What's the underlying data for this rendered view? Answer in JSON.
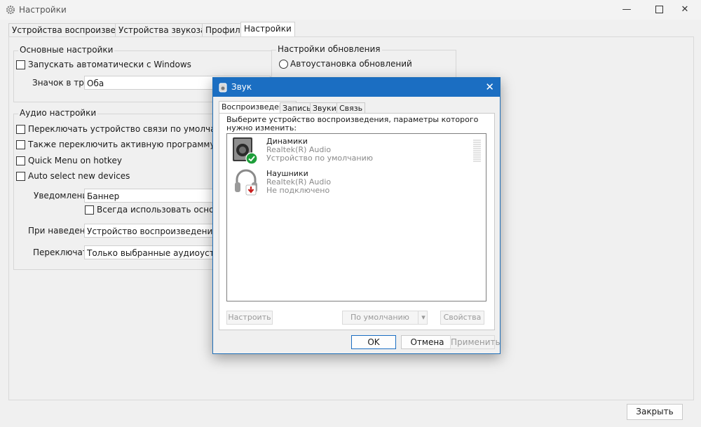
{
  "window": {
    "title": "Настройки",
    "close_button": "Закрыть"
  },
  "tabs": [
    "Устройства воспроизведения",
    "Устройства звукозаписи",
    "Профили",
    "Настройки"
  ],
  "active_tab": "Настройки",
  "basic_settings": {
    "title": "Основные настройки",
    "autostart_label": "Запускать автоматически с Windows",
    "tray_icon_label": "Значок в трее",
    "tray_icon_value": "Оба"
  },
  "update_settings": {
    "title": "Настройки обновления",
    "auto_update_label": "Автоустановка обновлений"
  },
  "audio_settings": {
    "title": "Аудио настройки",
    "switch_comm_label": "Переключать устройство связи по умолчанию",
    "switch_active_label": "Также переключить активную программу (переднего п",
    "quick_menu_label": "Quick Menu on hotkey",
    "auto_select_label": "Auto select new devices",
    "notification_label": "Уведомление",
    "notification_value": "Баннер",
    "always_use_label": "Всегда использовать основной экр",
    "hover_label": "При наведении",
    "hover_value": "Устройство воспроизведения",
    "switch_label": "Переключать",
    "switch_value": "Только выбранные аудиоустройства"
  },
  "sound_dialog": {
    "title": "Звук",
    "tabs": [
      "Воспроизведение",
      "Запись",
      "Звуки",
      "Связь"
    ],
    "instruction": "Выберите устройство воспроизведения, параметры которого нужно изменить:",
    "devices": [
      {
        "name": "Динамики",
        "driver": "Realtek(R) Audio",
        "status": "Устройство по умолчанию",
        "icon": "speaker-icon",
        "badge": "check-badge-icon",
        "badge_color": "#1e9e3a"
      },
      {
        "name": "Наушники",
        "driver": "Realtek(R) Audio",
        "status": "Не подключено",
        "icon": "headphones-icon",
        "badge": "down-arrow-badge-icon",
        "badge_color": "#c81d1d"
      }
    ],
    "configure_button": "Настроить",
    "default_button": "По умолчанию",
    "properties_button": "Свойства",
    "ok_button": "OK",
    "cancel_button": "Отмена",
    "apply_button": "Применить"
  }
}
